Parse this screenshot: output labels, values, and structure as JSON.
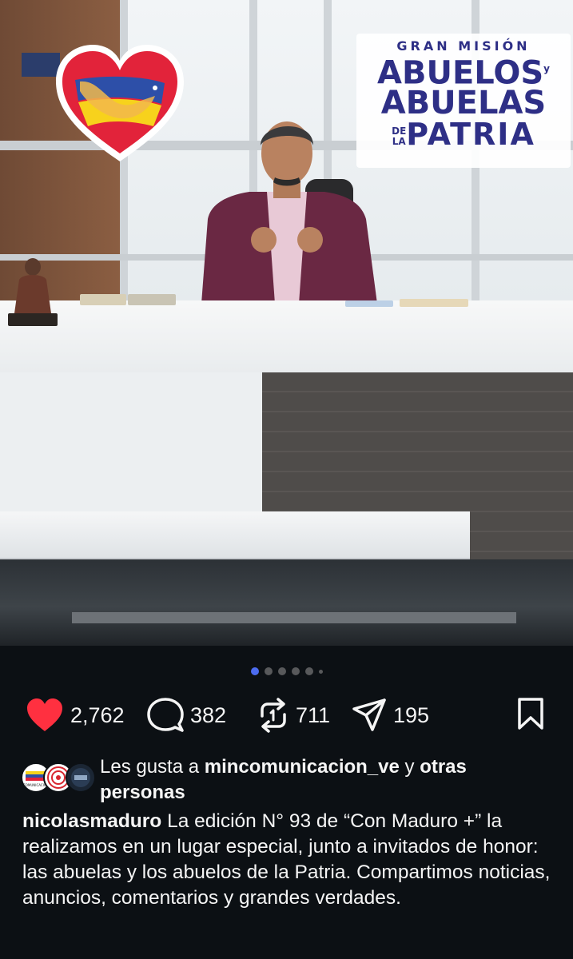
{
  "post": {
    "image": {
      "logo_icon": "heart-hug-logo",
      "sign_text": {
        "line1": "GRAN MISIÓN",
        "line2": "ABUELOS",
        "line2_y": "y",
        "line3": "ABUELAS",
        "line4_de": "DE",
        "line4_la": "LA",
        "line4": "PATRIA"
      }
    },
    "carousel": {
      "count": 6,
      "active_index": 0
    },
    "actions": {
      "like": {
        "icon": "heart-filled-icon",
        "count": "2,762",
        "color": "#ff3040"
      },
      "comment": {
        "icon": "comment-bubble-icon",
        "count": "382"
      },
      "repost": {
        "icon": "repost-icon",
        "count": "711"
      },
      "share": {
        "icon": "paper-plane-icon",
        "count": "195"
      },
      "save": {
        "icon": "bookmark-icon"
      }
    },
    "likes": {
      "prefix": "Les gusta a ",
      "user": "mincomunicacion_ve",
      "connector": " y ",
      "others": "otras personas",
      "avatar_label": "COMUNICACIÓN"
    },
    "caption": {
      "username": "nicolasmaduro",
      "text": " La edición N° 93 de “Con Maduro +” la realizamos en un lugar especial, junto a invitados de honor: las abuelas y los abuelos de la Patria. Compartimos noticias, anuncios, comentarios y grandes verdades."
    }
  }
}
